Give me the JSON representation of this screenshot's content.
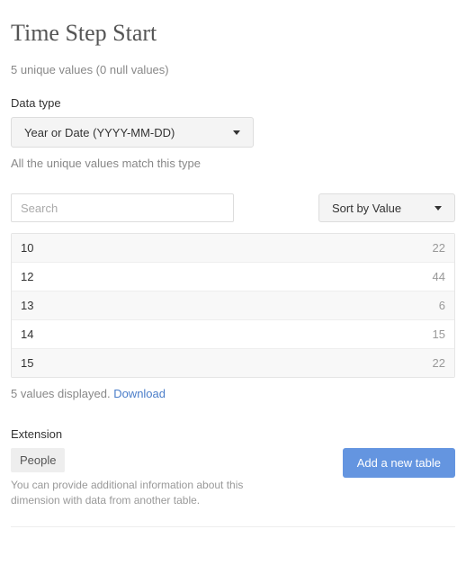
{
  "title": "Time Step Start",
  "subtitle": "5 unique values (0 null values)",
  "data_type": {
    "label": "Data type",
    "selected": "Year or Date (YYYY-MM-DD)",
    "hint": "All the unique values match this type"
  },
  "search": {
    "placeholder": "Search"
  },
  "sort": {
    "selected": "Sort by Value"
  },
  "rows": [
    {
      "value": "10",
      "count": "22"
    },
    {
      "value": "12",
      "count": "44"
    },
    {
      "value": "13",
      "count": "6"
    },
    {
      "value": "14",
      "count": "15"
    },
    {
      "value": "15",
      "count": "22"
    }
  ],
  "values_footer": "5 values displayed. ",
  "download": "Download",
  "extension": {
    "label": "Extension",
    "pill": "People",
    "hint": "You can provide additional information about this dimension with data from another table.",
    "button": "Add a new table"
  }
}
